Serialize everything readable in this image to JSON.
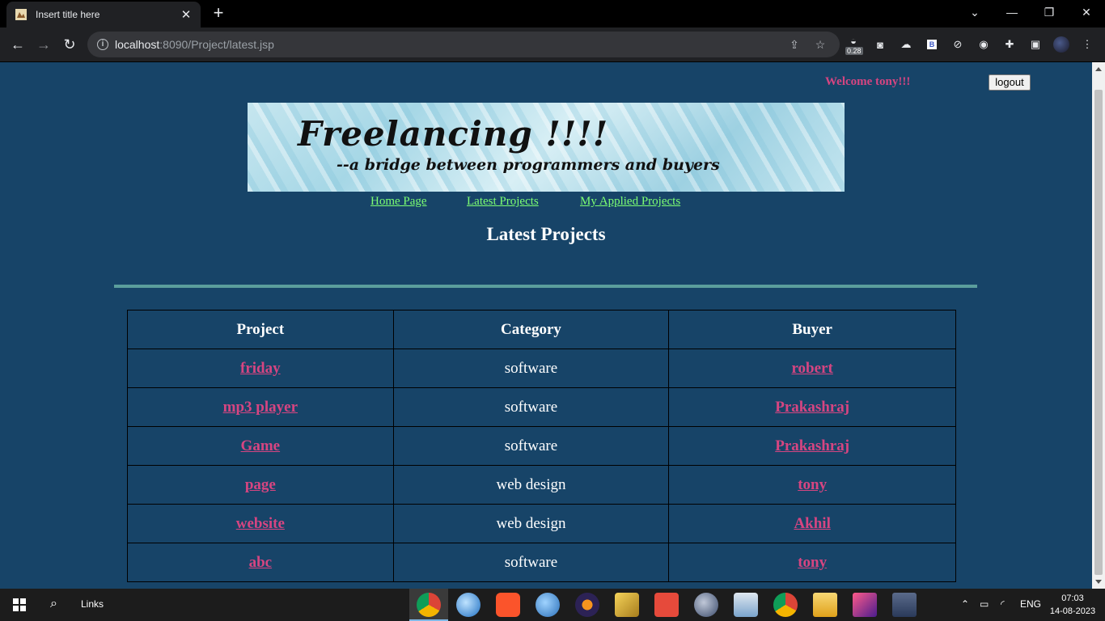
{
  "browser": {
    "tab_title": "Insert title here",
    "url_host": "localhost",
    "url_rest": ":8090/Project/latest.jsp",
    "extension_badge": "0.28"
  },
  "header": {
    "welcome": "Welcome tony!!!",
    "logout_label": "logout"
  },
  "banner": {
    "title": "Freelancing !!!!",
    "subtitle": "--a bridge between programmers and buyers"
  },
  "nav": {
    "links": [
      "Home Page",
      "Latest Projects",
      "My Applied Projects"
    ]
  },
  "page_title": "Latest Projects",
  "table": {
    "headers": [
      "Project",
      "Category",
      "Buyer"
    ],
    "rows": [
      {
        "project": "friday",
        "category": "software",
        "buyer": "robert"
      },
      {
        "project": "mp3 player",
        "category": "software",
        "buyer": "Prakashraj"
      },
      {
        "project": "Game",
        "category": "software",
        "buyer": "Prakashraj"
      },
      {
        "project": "page",
        "category": "web design",
        "buyer": "tony"
      },
      {
        "project": "website",
        "category": "web design",
        "buyer": "Akhil"
      },
      {
        "project": "abc",
        "category": "software",
        "buyer": "tony"
      }
    ]
  },
  "taskbar": {
    "links_label": "Links",
    "language": "ENG",
    "time": "07:03",
    "date": "14-08-2023"
  },
  "colors": {
    "page_bg": "#174468",
    "link_pink": "#d64581",
    "nav_green": "#7dff73",
    "rule_teal": "#5b9e9c"
  }
}
